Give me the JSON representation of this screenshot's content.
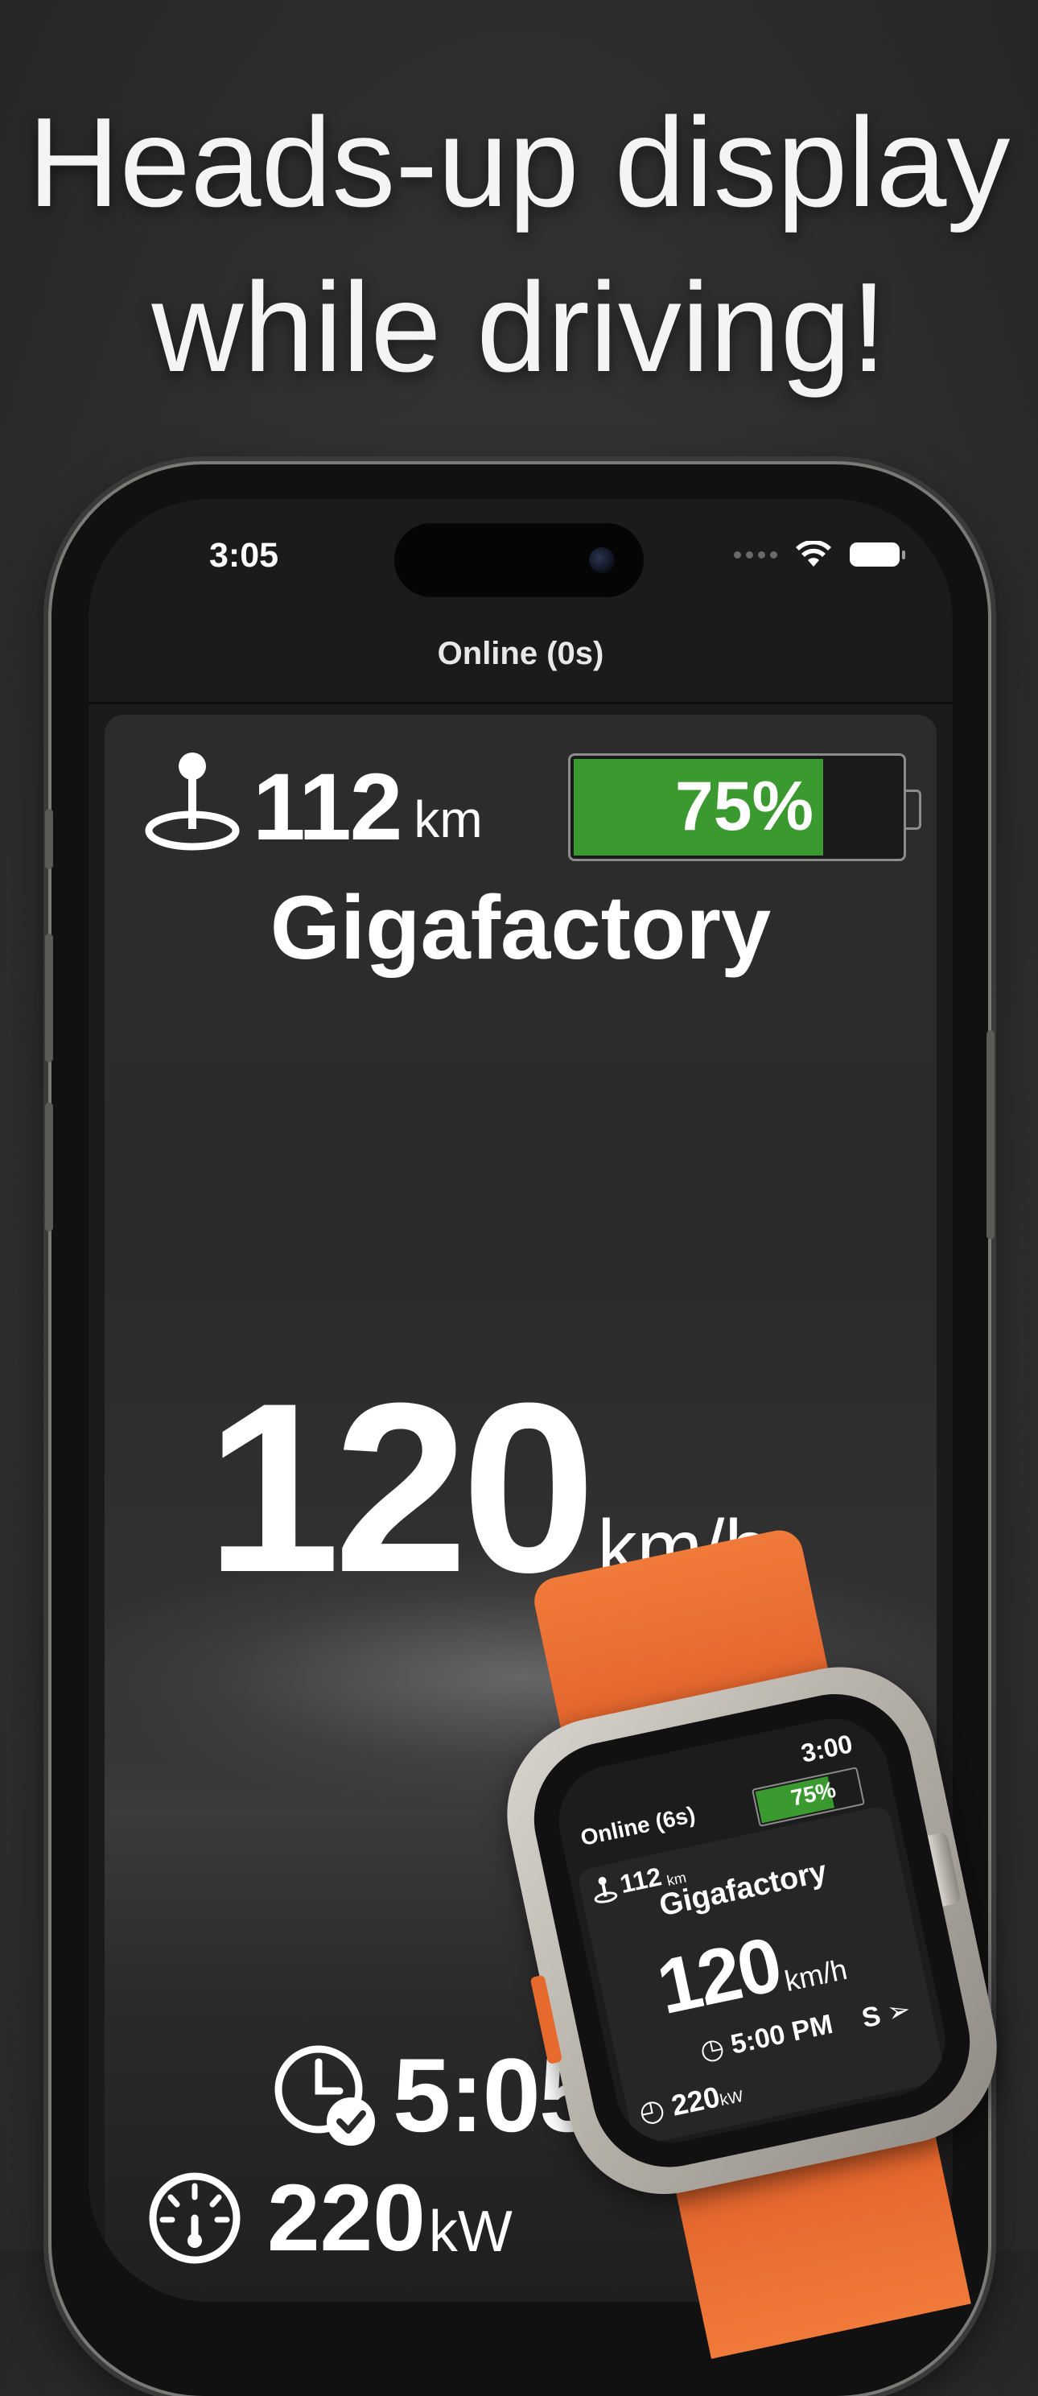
{
  "headline": {
    "line1": "Heads-up display",
    "line2": "while driving!"
  },
  "phone": {
    "status_time": "3:05",
    "connection": "Online (0s)",
    "distance": {
      "value": "112",
      "unit": "km"
    },
    "battery": {
      "percent_label": "75%",
      "level": 0.75,
      "fill_color": "#3a9a30"
    },
    "destination": "Gigafactory",
    "speed": {
      "value": "120",
      "unit": "km/h"
    },
    "eta": "5:05",
    "power": {
      "value": "220",
      "unit": "kW"
    },
    "icons": [
      "location-pin-icon",
      "battery-icon",
      "clock-check-icon",
      "gauge-icon",
      "wifi-icon",
      "cellular-dots-icon"
    ]
  },
  "watch": {
    "time": "3:00",
    "connection": "Online (6s)",
    "battery_label": "75%",
    "distance": {
      "value": "112",
      "unit": "km"
    },
    "destination": "Gigafactory",
    "speed": {
      "value": "120",
      "unit": "km/h"
    },
    "eta": "5:00 PM",
    "direction": "S",
    "power": {
      "value": "220",
      "unit": "kW"
    },
    "band_color": "#e8692c"
  }
}
